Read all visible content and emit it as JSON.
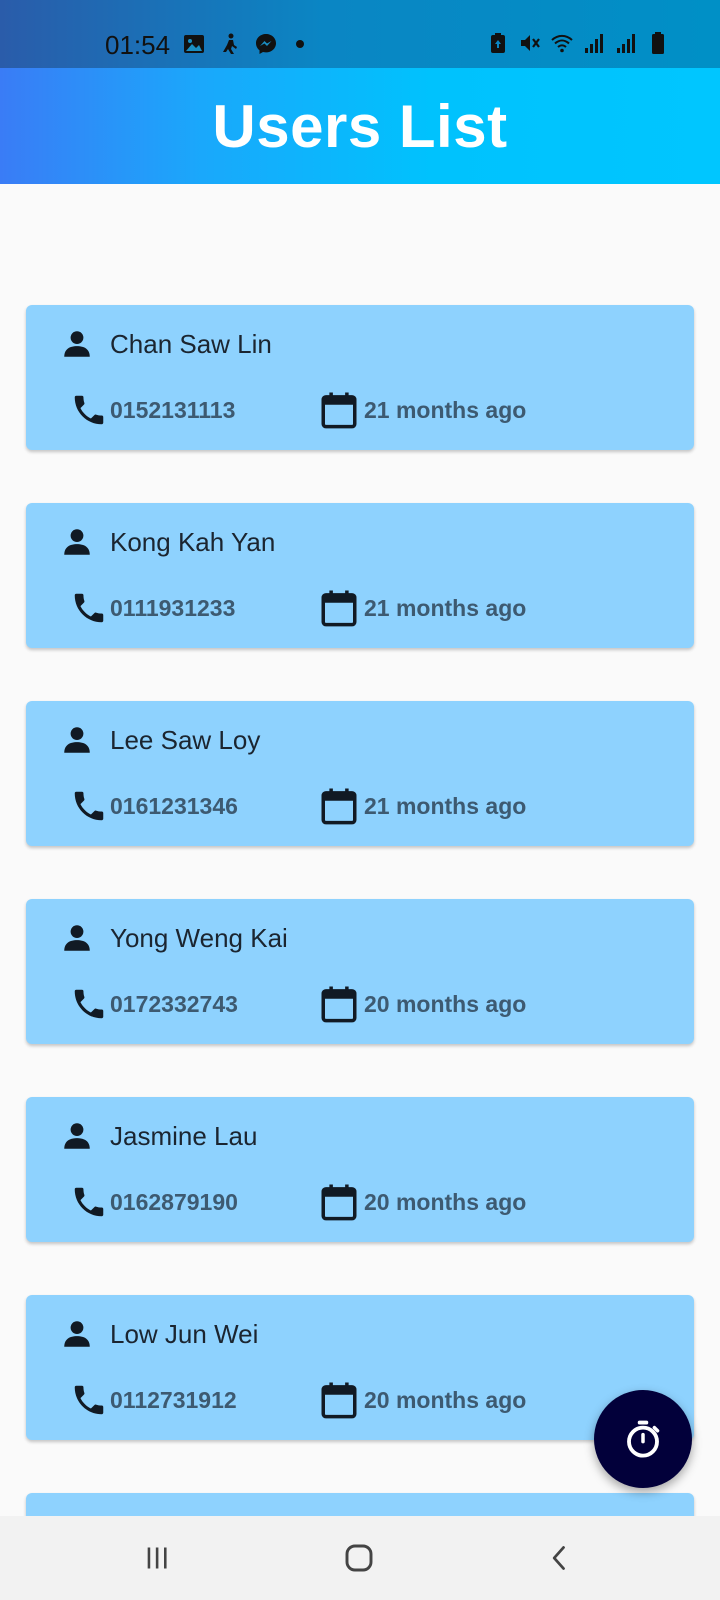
{
  "status_bar": {
    "time": "01:54",
    "left_icons": [
      "image-icon",
      "walking-person-icon",
      "messenger-icon",
      "notification-dot"
    ],
    "right_icons": [
      "battery-saver-icon",
      "mute-icon",
      "wifi-icon",
      "signal-icon",
      "signal-icon",
      "battery-icon"
    ]
  },
  "app_bar": {
    "title": "Users List",
    "gradient": [
      "#3a7cf6",
      "#00c6ff"
    ]
  },
  "colors": {
    "card_background": "#8ed2fe",
    "fab_background": "#02003a",
    "name_text": "#1b2530",
    "detail_text": "#3d5a71"
  },
  "users": [
    {
      "name": "Chan Saw Lin",
      "phone": "0152131113",
      "registered": "21 months ago"
    },
    {
      "name": "Kong Kah Yan",
      "phone": "0111931233",
      "registered": "21 months ago"
    },
    {
      "name": "Lee Saw Loy",
      "phone": "0161231346",
      "registered": "21 months ago"
    },
    {
      "name": "Yong Weng Kai",
      "phone": "0172332743",
      "registered": "20 months ago"
    },
    {
      "name": "Jasmine Lau",
      "phone": "0162879190",
      "registered": "20 months ago"
    },
    {
      "name": "Low Jun Wei",
      "phone": "0112731912",
      "registered": "20 months ago"
    }
  ],
  "fab": {
    "icon": "timer-icon"
  },
  "nav_bar": {
    "buttons": [
      "recents-button",
      "home-button",
      "back-button"
    ]
  }
}
